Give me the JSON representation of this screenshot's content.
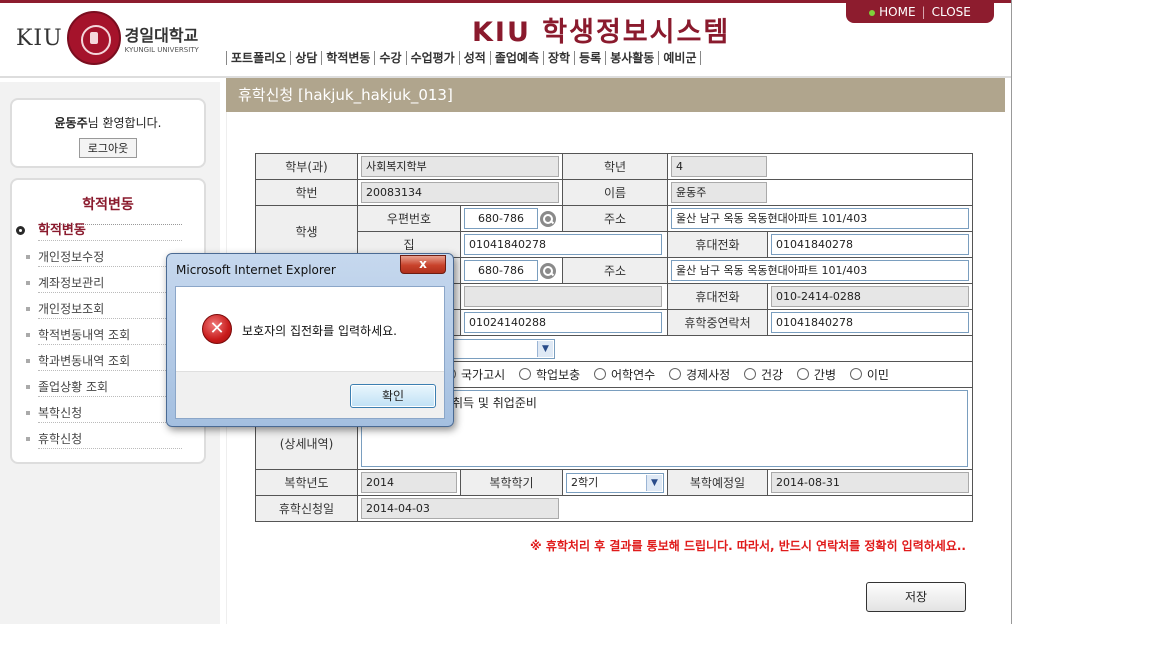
{
  "header": {
    "logo_kiu": "KIU",
    "univ_name": "경일대학교",
    "univ_name_en": "KYUNGIL UNIVERSITY",
    "system_title": "KIU 학생정보시스템",
    "home": "HOME",
    "close": "CLOSE",
    "menu": [
      "포트폴리오",
      "상담",
      "학적변동",
      "수강",
      "수업평가",
      "성적",
      "졸업예측",
      "장학",
      "등록",
      "봉사활동",
      "예비군"
    ]
  },
  "sidebar": {
    "welcome_name": "윤동주",
    "welcome_suffix": "님 환영합니다.",
    "logout": "로그아웃",
    "section_title": "학적변동",
    "items": [
      "학적변동",
      "개인정보수정",
      "계좌정보관리",
      "개인정보조회",
      "학적변동내역 조회",
      "학과변동내역 조회",
      "졸업상황 조회",
      "복학신청",
      "휴학신청"
    ]
  },
  "page_title": "휴학신청 [hakjuk_hakjuk_013]",
  "form": {
    "dept_label": "학부(과)",
    "dept": "사회복지학부",
    "year_label": "학년",
    "year": "4",
    "id_label": "학번",
    "id": "20083134",
    "name_label": "이름",
    "name": "윤동주",
    "student_label": "학생",
    "zip_label": "우편번호",
    "zip": "680-786",
    "addr_label": "주소",
    "addr": "울산 남구 옥동 옥동현대아파트 101/403",
    "home_label": "집",
    "home_phone": "01041840278",
    "mobile_label": "휴대전화",
    "mobile": "01041840278",
    "g_zip": "680-786",
    "g_addr": "울산 남구 옥동 옥동현대아파트 101/403",
    "g_mobile": "010-2414-0288",
    "g_home2": "01024140288",
    "leave_contact_label": "휴학중연락처",
    "leave_contact": "01041840278",
    "reasons": [
      "국가고시",
      "학업보충",
      "어학연수",
      "경제사정",
      "건강",
      "간병",
      "이민"
    ],
    "detail_text": "취득 및 취업준비",
    "detail_label": "(상세내역)",
    "return_year_label": "복학년도",
    "return_year": "2014",
    "return_term_label": "복학학기",
    "return_term": "2학기",
    "return_date_label": "복학예정일",
    "return_date": "2014-08-31",
    "apply_date_label": "휴학신청일",
    "apply_date": "2014-04-03"
  },
  "notice": "※ 휴학처리 후 결과를 통보해 드립니다. 따라서, 반드시 연락처를 정확히 입력하세요..",
  "save": "저장",
  "dialog": {
    "title": "Microsoft Internet Explorer",
    "close": "x",
    "icon": "error-icon",
    "message": "보호자의 집전화를 입력하세요.",
    "ok": "확인"
  }
}
